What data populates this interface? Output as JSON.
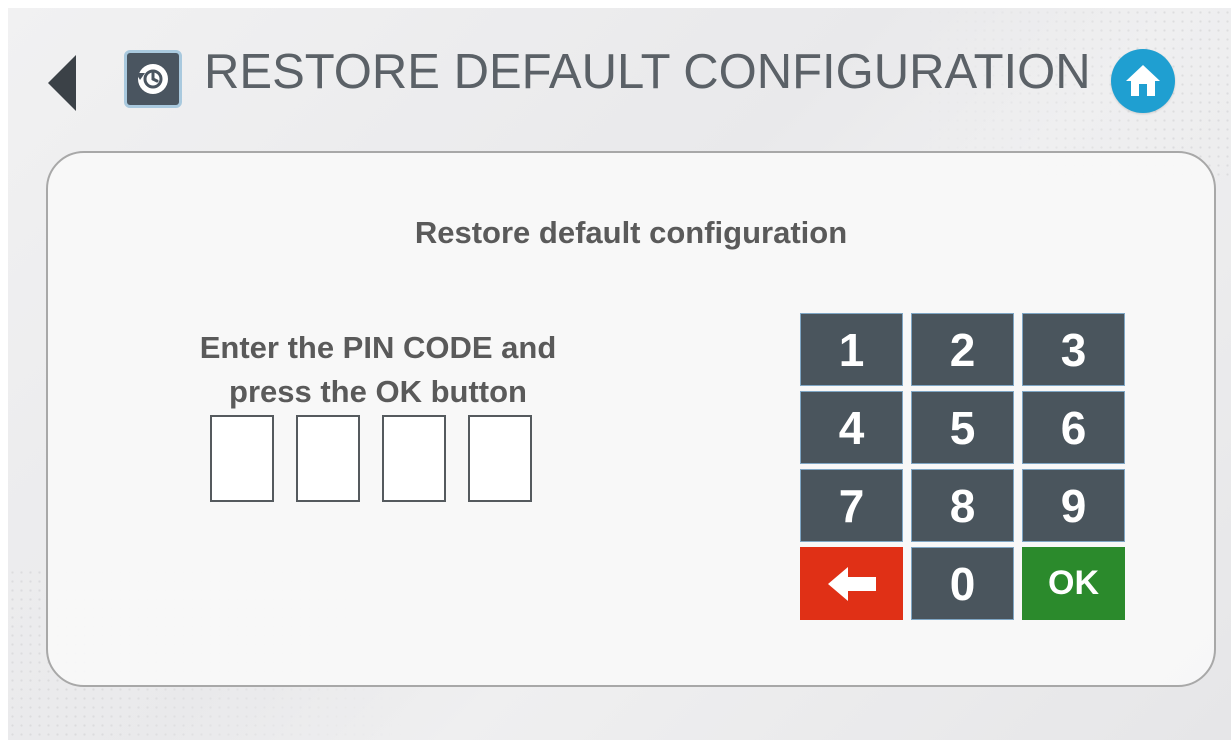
{
  "header": {
    "title": "RESTORE DEFAULT CONFIGURATION",
    "back_icon": "back-arrow-icon",
    "title_icon": "restore-icon",
    "home_icon": "home-icon",
    "home_color": "#1f9fd1"
  },
  "panel": {
    "heading": "Restore default configuration",
    "prompt_line1": "Enter the PIN CODE and",
    "prompt_line2": "press the OK button",
    "pin_length": 4
  },
  "keypad": {
    "keys": [
      "1",
      "2",
      "3",
      "4",
      "5",
      "6",
      "7",
      "8",
      "9",
      "⬅",
      "0",
      "OK"
    ],
    "backspace_color": "#e03016",
    "ok_color": "#2b8a2c",
    "digit_color": "#4a555d"
  }
}
